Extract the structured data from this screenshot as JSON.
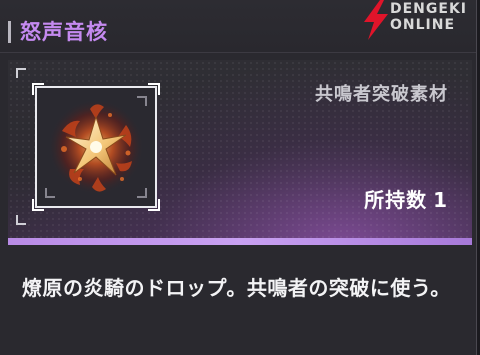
{
  "header": {
    "title": "怒声音核"
  },
  "watermark": {
    "line1": "DENGEKI",
    "line2": "ONLINE"
  },
  "item": {
    "category": "共鳴者突破素材",
    "owned_label": "所持数",
    "owned_count": "1",
    "image_icon": "flame-star-core-icon"
  },
  "description": {
    "text": "燎原の炎騎のドロップ。共鳴者の突破に使う。"
  },
  "colors": {
    "title": "#c58af0",
    "divider": "#b98be6",
    "background": "#2a292f"
  }
}
